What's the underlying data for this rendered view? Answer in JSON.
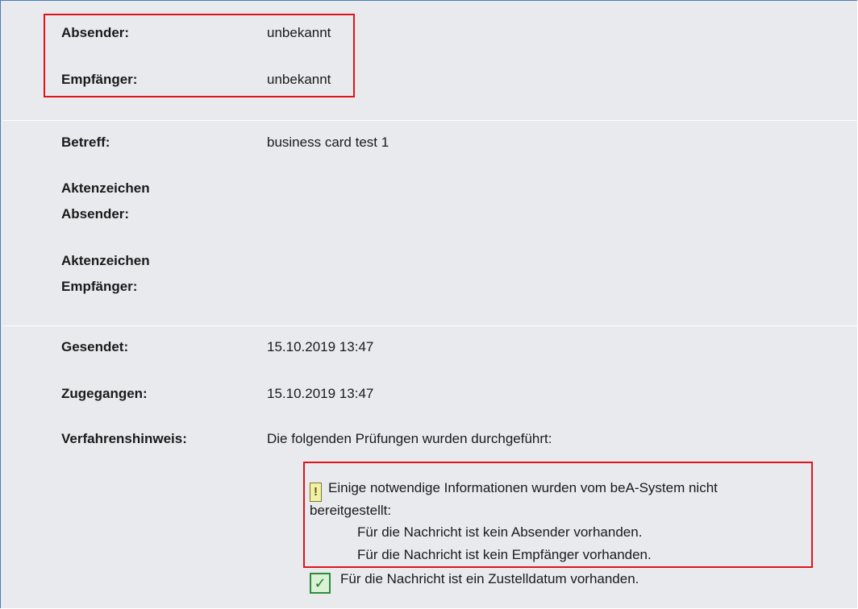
{
  "sender_block": {
    "absender_label": "Absender:",
    "absender_value": "unbekannt",
    "empfaenger_label": "Empfänger:",
    "empfaenger_value": "unbekannt"
  },
  "subject_block": {
    "betreff_label": "Betreff:",
    "betreff_value": "business card test 1",
    "az_absender_label_1": "Aktenzeichen",
    "az_absender_label_2": "Absender:",
    "az_empfaenger_label_1": "Aktenzeichen",
    "az_empfaenger_label_2": "Empfänger:"
  },
  "dates_block": {
    "gesendet_label": "Gesendet:",
    "gesendet_value": "15.10.2019 13:47",
    "zugegangen_label": "Zugegangen:",
    "zugegangen_value": "15.10.2019 13:47",
    "verfahren_label": "Verfahrenshinweis:",
    "verfahren_value": "Die folgenden Prüfungen wurden durchgeführt:"
  },
  "checks": {
    "warning_icon": "exclamation-icon",
    "warning_text_1": "Einige notwendige Informationen wurden vom beA-System nicht",
    "warning_text_2": "bereitgestellt:",
    "warning_detail_1": "Für die Nachricht ist kein Absender vorhanden.",
    "warning_detail_2": "Für die Nachricht ist kein Empfänger vorhanden.",
    "ok_icon": "checkmark-icon",
    "ok_text": "Für die Nachricht ist ein Zustelldatum vorhanden."
  },
  "colors": {
    "background": "#e9eaee",
    "highlight_border": "#e0141b",
    "ok_green": "#2e8b3a",
    "warning_yellow": "#f2f0a6"
  }
}
